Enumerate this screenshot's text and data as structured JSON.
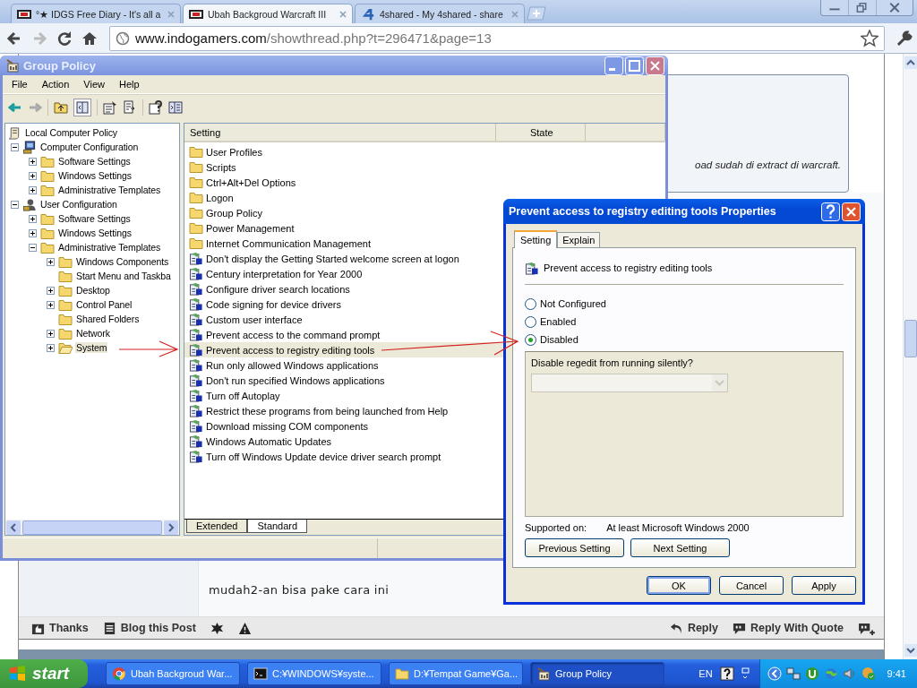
{
  "browser": {
    "tabs": [
      {
        "title": "°★ IDGS Free Diary - It's all a",
        "kind": "idgs",
        "selected": false
      },
      {
        "title": "Ubah Backgroud Warcraft III",
        "kind": "idgs",
        "selected": true
      },
      {
        "title": "4shared - My 4shared - share",
        "kind": "fourshared",
        "selected": false
      }
    ],
    "address": {
      "host": "www.indogamers.com",
      "path": "/showthread.php?t=296471&page=13"
    }
  },
  "page": {
    "quote_text": "oad sudah di extract di warcraft.",
    "post_text": "mudah2-an bisa pake cara ini",
    "actions_left": [
      {
        "label": "Thanks",
        "kind": "thanks"
      },
      {
        "label": "Blog this Post",
        "kind": "blog"
      },
      {
        "kind": "star"
      },
      {
        "kind": "warning"
      }
    ],
    "actions_right": [
      {
        "label": "Reply",
        "kind": "reply"
      },
      {
        "label": "Reply With Quote",
        "kind": "quote"
      },
      {
        "kind": "multiquote"
      }
    ]
  },
  "group_policy": {
    "title": "Group Policy",
    "menu": [
      "File",
      "Action",
      "View",
      "Help"
    ],
    "tree": [
      {
        "label": "Local Computer Policy",
        "kind": "policy",
        "expandable": false,
        "selected": false,
        "children": [
          {
            "label": "Computer Configuration",
            "kind": "computer",
            "expandable": true,
            "selected": false,
            "children": [
              {
                "label": "Software Settings",
                "kind": "folder",
                "expandable": true,
                "selected": false
              },
              {
                "label": "Windows Settings",
                "kind": "folder",
                "expandable": true,
                "selected": false
              },
              {
                "label": "Administrative Templates",
                "kind": "folder",
                "expandable": true,
                "selected": false
              }
            ]
          },
          {
            "label": "User Configuration",
            "kind": "user",
            "expandable": true,
            "selected": false,
            "children": [
              {
                "label": "Software Settings",
                "kind": "folder",
                "expandable": true,
                "selected": false
              },
              {
                "label": "Windows Settings",
                "kind": "folder",
                "expandable": true,
                "selected": false
              },
              {
                "label": "Administrative Templates",
                "kind": "folder",
                "expandable": true,
                "selected": false,
                "children": [
                  {
                    "label": "Windows Components",
                    "kind": "folder",
                    "expandable": true,
                    "selected": false
                  },
                  {
                    "label": "Start Menu and Taskba",
                    "kind": "folder",
                    "expandable": false,
                    "selected": false
                  },
                  {
                    "label": "Desktop",
                    "kind": "folder",
                    "expandable": true,
                    "selected": false
                  },
                  {
                    "label": "Control Panel",
                    "kind": "folder",
                    "expandable": true,
                    "selected": false
                  },
                  {
                    "label": "Shared Folders",
                    "kind": "folder",
                    "expandable": false,
                    "selected": false
                  },
                  {
                    "label": "Network",
                    "kind": "folder",
                    "expandable": true,
                    "selected": false
                  },
                  {
                    "label": "System",
                    "kind": "folder",
                    "expandable": true,
                    "selected": true
                  }
                ]
              }
            ]
          }
        ]
      }
    ],
    "columns": [
      "Setting",
      "State"
    ],
    "rows": [
      {
        "label": "User Profiles",
        "kind": "folder",
        "selected": false
      },
      {
        "label": "Scripts",
        "kind": "folder",
        "selected": false
      },
      {
        "label": "Ctrl+Alt+Del Options",
        "kind": "folder",
        "selected": false
      },
      {
        "label": "Logon",
        "kind": "folder",
        "selected": false
      },
      {
        "label": "Group Policy",
        "kind": "folder",
        "selected": false
      },
      {
        "label": "Power Management",
        "kind": "folder",
        "selected": false
      },
      {
        "label": "Internet Communication Management",
        "kind": "folder",
        "selected": false
      },
      {
        "label": "Don't display the Getting Started welcome screen at logon",
        "kind": "setting",
        "selected": false
      },
      {
        "label": "Century interpretation for Year 2000",
        "kind": "setting",
        "selected": false
      },
      {
        "label": "Configure driver search locations",
        "kind": "setting",
        "selected": false
      },
      {
        "label": "Code signing for device drivers",
        "kind": "setting",
        "selected": false
      },
      {
        "label": "Custom user interface",
        "kind": "setting",
        "selected": false
      },
      {
        "label": "Prevent access to the command prompt",
        "kind": "setting",
        "selected": false
      },
      {
        "label": "Prevent access to registry editing tools",
        "kind": "setting",
        "selected": true
      },
      {
        "label": "Run only allowed Windows applications",
        "kind": "setting",
        "selected": false
      },
      {
        "label": "Don't run specified Windows applications",
        "kind": "setting",
        "selected": false
      },
      {
        "label": "Turn off Autoplay",
        "kind": "setting",
        "selected": false
      },
      {
        "label": "Restrict these programs from being launched from Help",
        "kind": "setting",
        "selected": false
      },
      {
        "label": "Download missing COM components",
        "kind": "setting",
        "selected": false
      },
      {
        "label": "Windows Automatic Updates",
        "kind": "setting",
        "selected": false
      },
      {
        "label": "Turn off Windows Update device driver search prompt",
        "kind": "setting",
        "selected": false
      }
    ],
    "view_tabs": [
      {
        "label": "Extended",
        "selected": false
      },
      {
        "label": "Standard",
        "selected": true
      }
    ]
  },
  "dialog": {
    "title": "Prevent access to registry editing tools Properties",
    "tabs": [
      {
        "label": "Setting",
        "selected": true
      },
      {
        "label": "Explain",
        "selected": false
      }
    ],
    "policy": "Prevent access to registry editing tools",
    "options": [
      {
        "label": "Not Configured",
        "selected": false
      },
      {
        "label": "Enabled",
        "selected": false
      },
      {
        "label": "Disabled",
        "selected": true
      }
    ],
    "option_label": "Disable regedit from running silently?",
    "supported_label": "Supported on:",
    "supported_value": "At least Microsoft Windows 2000",
    "nav_buttons": [
      "Previous Setting",
      "Next Setting"
    ],
    "buttons": [
      {
        "label": "OK",
        "default": true
      },
      {
        "label": "Cancel",
        "default": false
      },
      {
        "label": "Apply",
        "default": false
      }
    ]
  },
  "taskbar": {
    "start": "start",
    "tasks": [
      {
        "label": "Ubah Backgroud War...",
        "kind": "chrome",
        "selected": false
      },
      {
        "label": "C:¥WINDOWS¥syste...",
        "kind": "console",
        "selected": false
      },
      {
        "label": "D:¥Tempat Game¥Ga...",
        "kind": "folder",
        "selected": false
      },
      {
        "label": "Group Policy",
        "kind": "policy",
        "selected": true
      }
    ],
    "language": "EN",
    "clock": "9:41"
  }
}
